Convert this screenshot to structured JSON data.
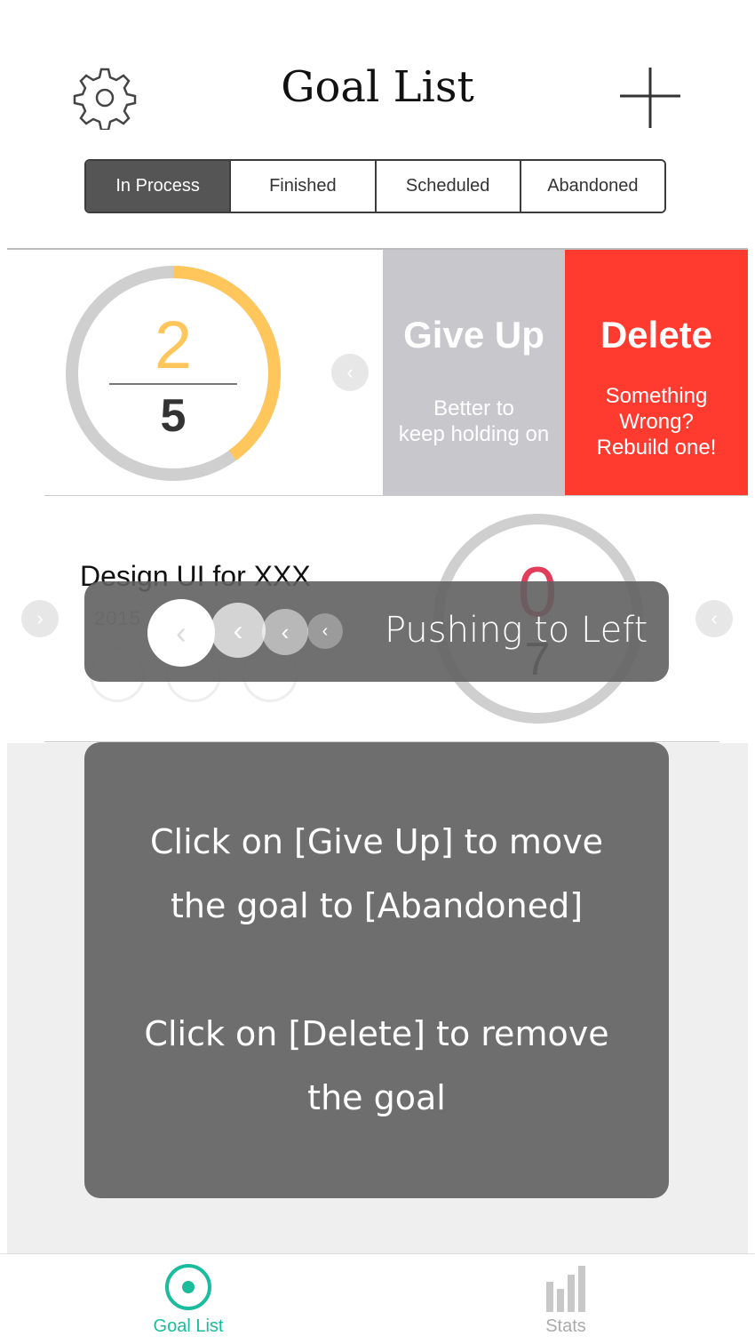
{
  "header": {
    "title": "Goal List"
  },
  "icons": {
    "settings": "gear-icon",
    "add": "plus-icon"
  },
  "tabs": [
    {
      "label": "In Process",
      "active": true
    },
    {
      "label": "Finished",
      "active": false
    },
    {
      "label": "Scheduled",
      "active": false
    },
    {
      "label": "Abandoned",
      "active": false
    }
  ],
  "goal_row_1": {
    "progress_done": "2",
    "progress_total": "5",
    "give_up": {
      "title": "Give Up",
      "subtitle_line1": "Better to",
      "subtitle_line2": "keep holding on"
    },
    "delete": {
      "title": "Delete",
      "subtitle_line1": "Something",
      "subtitle_line2": "Wrong?",
      "subtitle_line3": "Rebuild one!"
    }
  },
  "goal_row_2": {
    "title": "Design UI for XXX",
    "date": "2015",
    "progress_done": "0",
    "progress_total": "7"
  },
  "overlay": {
    "push_hint": "Pushing to Left",
    "info_line1": "Click on [Give Up] to move",
    "info_line2": "the goal to [Abandoned]",
    "info_line3": "Click on [Delete] to remove",
    "info_line4": "the goal"
  },
  "bottom_nav": {
    "goal_list": "Goal List",
    "stats": "Stats"
  },
  "colors": {
    "accent": "#1abc9c",
    "delete": "#ff3b30",
    "give_up": "#c8c8cc",
    "progress": "#ffc65c",
    "progress_red": "#e23c5a"
  }
}
